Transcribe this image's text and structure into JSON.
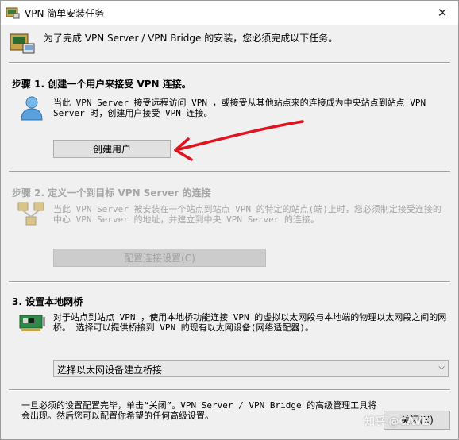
{
  "window": {
    "title": "VPN 简单安装任务",
    "close_glyph": "✕"
  },
  "intro": "为了完成 VPN Server / VPN Bridge 的安装，您必须完成以下任务。",
  "step1": {
    "title": "步骤 1. 创建一个用户来接受 VPN 连接。",
    "desc": "当此 VPN Server 接受远程访问 VPN ，或接受从其他站点来的连接成为中央站点到站点 VPN Server 时，创建用户接受 VPN 连接。",
    "button": "创建用户"
  },
  "step2": {
    "title": "步骤 2. 定义一个到目标 VPN Server 的连接",
    "desc": "当此 VPN Server 被安装在一个站点到站点 VPN 的特定的站点(端)上时，您必须制定接受连接的中心 VPN Server 的地址，并建立到中央 VPN Server 的连接。",
    "button": "配置连接设置(C)"
  },
  "step3": {
    "title": "3. 设置本地网桥",
    "desc": "对于站点到站点 VPN ，使用本地桥功能连接 VPN 的虚拟以太网段与本地端的物理以太网段之间的网桥。 选择可以提供桥接到 VPN 的现有以太网设备(网络适配器)。",
    "combo_value": "选择以太网设备建立桥接"
  },
  "footer": {
    "text": "一旦必须的设置配置完毕，单击“关闭”。VPN Server / VPN Bridge 的高级管理工具将会出现。然后您可以配置你希望的任何高级设置。",
    "close_button": "关闭(X)",
    "watermark": "知乎 @CAVE"
  },
  "colors": {
    "annotation_arrow": "#e0141e",
    "disabled_text": "#a6a6a6"
  }
}
